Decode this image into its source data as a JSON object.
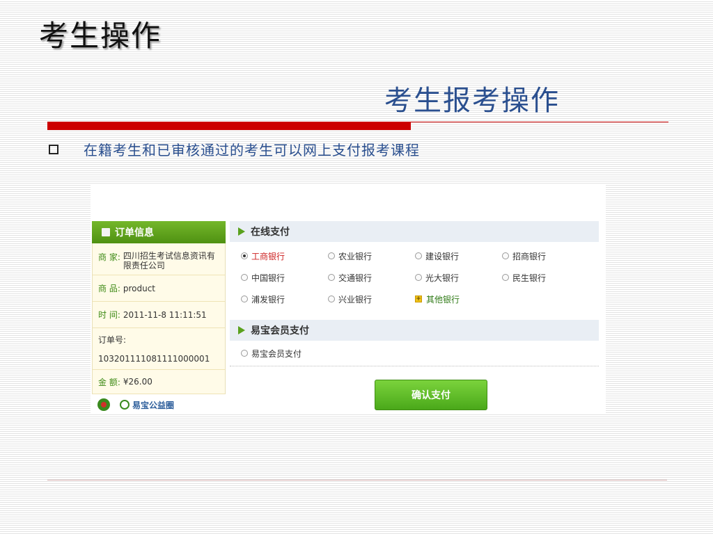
{
  "slide": {
    "title": "考生操作",
    "subtitle": "考生报考操作",
    "bullet": "在籍考生和已审核通过的考生可以网上支付报考课程"
  },
  "order": {
    "header": "订单信息",
    "merchant_label": "商 家:",
    "merchant_value": "四川招生考试信息资讯有限责任公司",
    "product_label": "商 品:",
    "product_value": "product",
    "time_label": "时 间:",
    "time_value": "2011-11-8 11:11:51",
    "order_no_label": "订单号:",
    "order_no_value": "103201111081111000001",
    "amount_label": "金 额:",
    "amount_value": "¥26.00",
    "logo_text": "易宝公益圈"
  },
  "payment": {
    "online_title": "在线支付",
    "banks": [
      {
        "label": "工商银行",
        "selected": true
      },
      {
        "label": "农业银行",
        "selected": false
      },
      {
        "label": "建设银行",
        "selected": false
      },
      {
        "label": "招商银行",
        "selected": false
      },
      {
        "label": "中国银行",
        "selected": false
      },
      {
        "label": "交通银行",
        "selected": false
      },
      {
        "label": "光大银行",
        "selected": false
      },
      {
        "label": "民生银行",
        "selected": false
      },
      {
        "label": "浦发银行",
        "selected": false
      },
      {
        "label": "兴业银行",
        "selected": false
      }
    ],
    "other_banks": "其他银行",
    "member_title": "易宝会员支付",
    "member_option": "易宝会员支付",
    "confirm_label": "确认支付"
  },
  "colors": {
    "accent_red": "#cc0000",
    "title_blue": "#2a4f8f",
    "green": "#4f9112"
  }
}
